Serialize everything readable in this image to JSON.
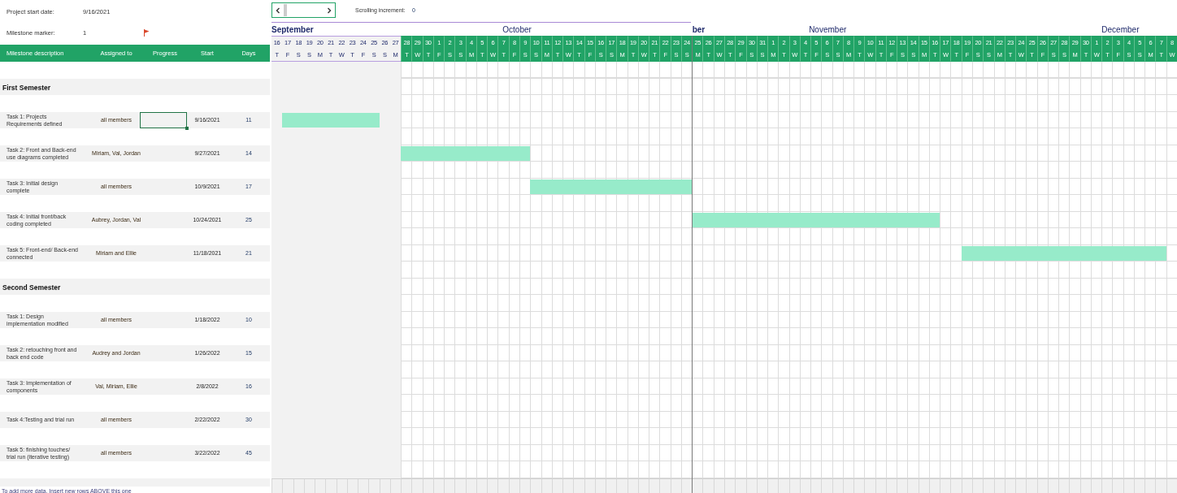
{
  "project_start_date": {
    "label": "Project start date:",
    "value": "9/16/2021"
  },
  "milestone_marker": {
    "label": "Milestone marker:",
    "value": "1"
  },
  "scrolling_increment": {
    "label": "Scrolling increment:",
    "value": "0"
  },
  "table": {
    "columns": [
      "Milestone description",
      "Assigned to",
      "Progress",
      "Start",
      "Days"
    ],
    "sections": [
      {
        "title": "First Semester",
        "tasks": [
          {
            "description": "Task 1: Projects Requirements defined",
            "assigned_to": "all members",
            "progress_selected": true,
            "start": "9/16/2021",
            "days": "11"
          },
          {
            "description": "Task 2: Front and Back-end use diagrams completed",
            "assigned_to": "Miriam, Val, Jordan",
            "progress_selected": false,
            "start": "9/27/2021",
            "days": "14"
          },
          {
            "description": "Task 3: Initial design complete",
            "assigned_to": "all members",
            "progress_selected": false,
            "start": "10/9/2021",
            "days": "17"
          },
          {
            "description": "Task 4: Initial front/back coding completed",
            "assigned_to": "Aubrey, Jordan, Val",
            "progress_selected": false,
            "start": "10/24/2021",
            "days": "25"
          },
          {
            "description": "Task 5: Front-end/ Back-end connected",
            "assigned_to": "Miriam and Ellie",
            "progress_selected": false,
            "start": "11/18/2021",
            "days": "21"
          }
        ]
      },
      {
        "title": "Second Semester",
        "tasks": [
          {
            "description": "Task 1: Design implementation modified",
            "assigned_to": "all members",
            "progress_selected": false,
            "start": "1/18/2022",
            "days": "10"
          },
          {
            "description": "Task 2:  retouching front and back end code",
            "assigned_to": "Audrey and Jordan",
            "progress_selected": false,
            "start": "1/26/2022",
            "days": "15"
          },
          {
            "description": "Task 3: Implementation of components",
            "assigned_to": "Val, Miriam, Ellie",
            "progress_selected": false,
            "start": "2/8/2022",
            "days": "16"
          },
          {
            "description": "Task 4:Testing and trial run",
            "assigned_to": "all members",
            "progress_selected": false,
            "start": "2/22/2022",
            "days": "30"
          },
          {
            "description": "Task 5: finishing touches/ trial run (iterative testing)",
            "assigned_to": "all members",
            "progress_selected": false,
            "start": "3/22/2022",
            "days": "45"
          }
        ]
      }
    ]
  },
  "footer": "To add more data, Insert new rows ABOVE this one",
  "timeline": {
    "days": [
      {
        "day": "16",
        "weekday": "T",
        "highlighted": false,
        "month": {
          "label": "September",
          "bold": true
        }
      },
      {
        "day": "17",
        "weekday": "F",
        "highlighted": false
      },
      {
        "day": "18",
        "weekday": "S",
        "highlighted": false
      },
      {
        "day": "19",
        "weekday": "S",
        "highlighted": false
      },
      {
        "day": "20",
        "weekday": "M",
        "highlighted": false
      },
      {
        "day": "21",
        "weekday": "T",
        "highlighted": false
      },
      {
        "day": "22",
        "weekday": "W",
        "highlighted": false
      },
      {
        "day": "23",
        "weekday": "T",
        "highlighted": false
      },
      {
        "day": "24",
        "weekday": "F",
        "highlighted": false
      },
      {
        "day": "25",
        "weekday": "S",
        "highlighted": false
      },
      {
        "day": "26",
        "weekday": "S",
        "highlighted": false
      },
      {
        "day": "27",
        "weekday": "M",
        "highlighted": false
      },
      {
        "day": "28",
        "weekday": "T",
        "highlighted": true
      },
      {
        "day": "29",
        "weekday": "W",
        "highlighted": true
      },
      {
        "day": "30",
        "weekday": "T",
        "highlighted": true
      },
      {
        "day": "1",
        "weekday": "F",
        "highlighted": true
      },
      {
        "day": "2",
        "weekday": "S",
        "highlighted": true
      },
      {
        "day": "3",
        "weekday": "S",
        "highlighted": true
      },
      {
        "day": "4",
        "weekday": "M",
        "highlighted": true
      },
      {
        "day": "5",
        "weekday": "T",
        "highlighted": true
      },
      {
        "day": "6",
        "weekday": "W",
        "highlighted": true
      },
      {
        "day": "7",
        "weekday": "T",
        "highlighted": true,
        "month": {
          "label": "October",
          "bold": false
        }
      },
      {
        "day": "8",
        "weekday": "F",
        "highlighted": true
      },
      {
        "day": "9",
        "weekday": "S",
        "highlighted": true
      },
      {
        "day": "10",
        "weekday": "S",
        "highlighted": true
      },
      {
        "day": "11",
        "weekday": "M",
        "highlighted": true
      },
      {
        "day": "12",
        "weekday": "T",
        "highlighted": true
      },
      {
        "day": "13",
        "weekday": "W",
        "highlighted": true
      },
      {
        "day": "14",
        "weekday": "T",
        "highlighted": true
      },
      {
        "day": "15",
        "weekday": "F",
        "highlighted": true
      },
      {
        "day": "16",
        "weekday": "S",
        "highlighted": true
      },
      {
        "day": "17",
        "weekday": "S",
        "highlighted": true
      },
      {
        "day": "18",
        "weekday": "M",
        "highlighted": true
      },
      {
        "day": "19",
        "weekday": "T",
        "highlighted": true
      },
      {
        "day": "20",
        "weekday": "W",
        "highlighted": true
      },
      {
        "day": "21",
        "weekday": "T",
        "highlighted": true
      },
      {
        "day": "22",
        "weekday": "F",
        "highlighted": true
      },
      {
        "day": "23",
        "weekday": "S",
        "highlighted": true
      },
      {
        "day": "24",
        "weekday": "S",
        "highlighted": true
      },
      {
        "day": "25",
        "weekday": "M",
        "highlighted": true,
        "pane_start": true,
        "month": {
          "label": "ber",
          "bold": true
        }
      },
      {
        "day": "26",
        "weekday": "T",
        "highlighted": true
      },
      {
        "day": "27",
        "weekday": "W",
        "highlighted": true
      },
      {
        "day": "28",
        "weekday": "T",
        "highlighted": true
      },
      {
        "day": "29",
        "weekday": "F",
        "highlighted": true
      },
      {
        "day": "30",
        "weekday": "S",
        "highlighted": true
      },
      {
        "day": "31",
        "weekday": "S",
        "highlighted": true
      },
      {
        "day": "1",
        "weekday": "M",
        "highlighted": true
      },
      {
        "day": "2",
        "weekday": "T",
        "highlighted": true
      },
      {
        "day": "3",
        "weekday": "W",
        "highlighted": true
      },
      {
        "day": "4",
        "weekday": "T",
        "highlighted": true
      },
      {
        "day": "5",
        "weekday": "F",
        "highlighted": true
      },
      {
        "day": "6",
        "weekday": "S",
        "highlighted": true,
        "month": {
          "label": "November",
          "bold": false
        }
      },
      {
        "day": "7",
        "weekday": "S",
        "highlighted": true
      },
      {
        "day": "8",
        "weekday": "M",
        "highlighted": true
      },
      {
        "day": "9",
        "weekday": "T",
        "highlighted": true
      },
      {
        "day": "10",
        "weekday": "W",
        "highlighted": true
      },
      {
        "day": "11",
        "weekday": "T",
        "highlighted": true
      },
      {
        "day": "12",
        "weekday": "F",
        "highlighted": true
      },
      {
        "day": "13",
        "weekday": "S",
        "highlighted": true
      },
      {
        "day": "14",
        "weekday": "S",
        "highlighted": true
      },
      {
        "day": "15",
        "weekday": "M",
        "highlighted": true
      },
      {
        "day": "16",
        "weekday": "T",
        "highlighted": true
      },
      {
        "day": "17",
        "weekday": "W",
        "highlighted": true
      },
      {
        "day": "18",
        "weekday": "T",
        "highlighted": true
      },
      {
        "day": "19",
        "weekday": "F",
        "highlighted": true
      },
      {
        "day": "20",
        "weekday": "S",
        "highlighted": true
      },
      {
        "day": "21",
        "weekday": "S",
        "highlighted": true
      },
      {
        "day": "22",
        "weekday": "M",
        "highlighted": true
      },
      {
        "day": "23",
        "weekday": "T",
        "highlighted": true
      },
      {
        "day": "24",
        "weekday": "W",
        "highlighted": true
      },
      {
        "day": "25",
        "weekday": "T",
        "highlighted": true
      },
      {
        "day": "26",
        "weekday": "F",
        "highlighted": true
      },
      {
        "day": "27",
        "weekday": "S",
        "highlighted": true
      },
      {
        "day": "28",
        "weekday": "S",
        "highlighted": true
      },
      {
        "day": "29",
        "weekday": "M",
        "highlighted": true
      },
      {
        "day": "30",
        "weekday": "T",
        "highlighted": true
      },
      {
        "day": "1",
        "weekday": "W",
        "highlighted": true
      },
      {
        "day": "2",
        "weekday": "T",
        "highlighted": true
      },
      {
        "day": "3",
        "weekday": "F",
        "highlighted": true
      },
      {
        "day": "4",
        "weekday": "S",
        "highlighted": true,
        "month": {
          "label": "December",
          "bold": false
        }
      },
      {
        "day": "5",
        "weekday": "S",
        "highlighted": true
      },
      {
        "day": "6",
        "weekday": "M",
        "highlighted": true
      },
      {
        "day": "7",
        "weekday": "T",
        "highlighted": true
      },
      {
        "day": "8",
        "weekday": "W",
        "highlighted": true
      }
    ]
  }
}
